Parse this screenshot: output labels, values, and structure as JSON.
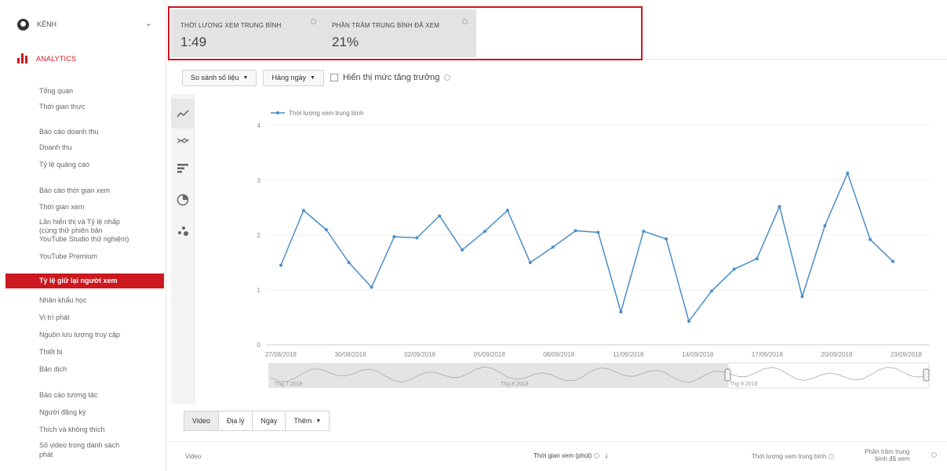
{
  "sidebar": {
    "channel_name": "KÊNH",
    "analytics_label": "ANALYTICS",
    "items": [
      {
        "label": "Tổng quan",
        "top": 0
      },
      {
        "label": "Thời gian thực",
        "top": 0
      },
      {
        "label": "Báo cáo doanh thu",
        "top": 0
      },
      {
        "label": "Doanh thu",
        "top": 0
      },
      {
        "label": "Tỷ lệ quảng cáo",
        "top": 0
      },
      {
        "label": "Báo cáo thời gian xem",
        "top": 0
      },
      {
        "label": "Thời gian xem",
        "top": 0
      },
      {
        "label": "Lần hiển thị và Tỷ lệ nhấp",
        "top": 0
      },
      {
        "label": "(cùng thử phiên bản",
        "top": 0
      },
      {
        "label": "YouTube Studio thử nghiệm)",
        "top": 0
      },
      {
        "label": "YouTube Premium",
        "top": 0
      },
      {
        "label": "Tỷ lệ giữ lại người xem",
        "top": 0
      },
      {
        "label": "Nhân khẩu học",
        "top": 0
      },
      {
        "label": "Vị trí phát",
        "top": 0
      },
      {
        "label": "Nguồn lưu lượng truy cập",
        "top": 0
      },
      {
        "label": "Thiết bị",
        "top": 0
      },
      {
        "label": "Bản dịch",
        "top": 0
      },
      {
        "label": "Báo cáo tương tác",
        "top": 0
      },
      {
        "label": "Người đăng ký",
        "top": 0
      },
      {
        "label": "Thích và không thích",
        "top": 0
      },
      {
        "label": "Số video trong danh sách",
        "top": 0
      },
      {
        "label": "phát",
        "top": 0
      }
    ]
  },
  "metrics": [
    {
      "title": "THỜI LƯỢNG XEM TRUNG BÌNH",
      "value": "1:49"
    },
    {
      "title": "PHẦN TRĂM TRUNG BÌNH ĐÃ XEM",
      "value": "21%"
    }
  ],
  "controls": {
    "compare_label": "So sánh số liệu",
    "daily_label": "Hàng ngày",
    "growth_label": "Hiển thị mức tăng trưởng"
  },
  "bottom_tabs": [
    "Video",
    "Địa lý",
    "Ngày",
    "Thêm"
  ],
  "table_headers": {
    "video": "Video",
    "watch_time": "Thời gian xem (phút)",
    "avg_duration": "Thời lượng xem trung bình",
    "avg_percent_line1": "Phần trăm trung",
    "avg_percent_line2": "bình đã xem"
  },
  "colors": {
    "accent": "#cc181e",
    "line": "#4a8ec8"
  },
  "chart_data": {
    "type": "line",
    "series": [
      {
        "name": "Thời lượng xem trung bình",
        "values": [
          1.45,
          2.45,
          2.1,
          1.5,
          1.05,
          1.97,
          1.95,
          2.35,
          1.73,
          2.07,
          2.45,
          1.5,
          1.78,
          2.08,
          2.05,
          0.6,
          2.07,
          1.93,
          0.43,
          0.98,
          1.38,
          1.57,
          2.52,
          0.88,
          2.17,
          3.13,
          1.92,
          1.52
        ]
      }
    ],
    "ylim": [
      0,
      4
    ],
    "yticks": [
      "0",
      "1",
      "2",
      "3",
      "4"
    ],
    "xtick_labels": [
      "27/08/2018",
      "30/08/2018",
      "02/09/2018",
      "05/09/2018",
      "08/09/2018",
      "11/09/2018",
      "14/09/2018",
      "17/09/2018",
      "20/09/2018",
      "23/09/2018"
    ],
    "navigator_labels": [
      "Thg 7 2018",
      "Thg 8 2018",
      "Thg 9 2018"
    ],
    "grid": true,
    "legend_position": "top-left"
  }
}
